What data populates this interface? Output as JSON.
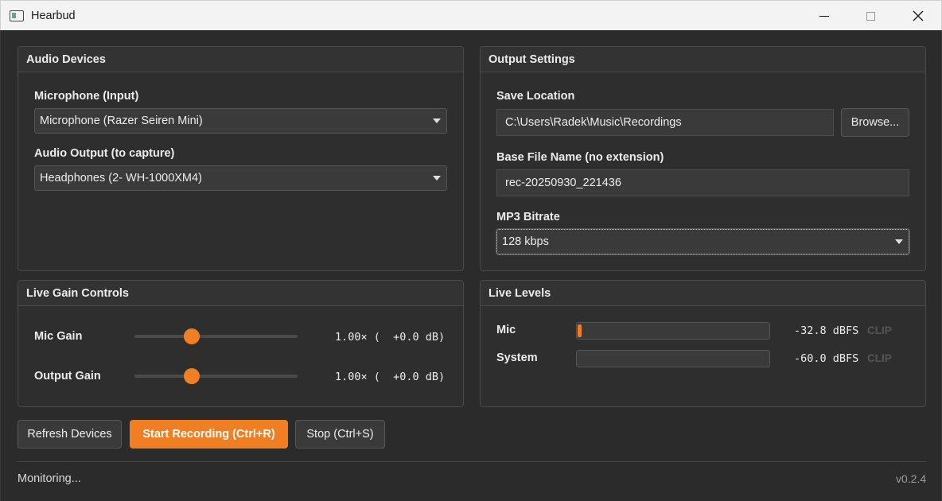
{
  "window": {
    "title": "Hearbud"
  },
  "audio_devices": {
    "header": "Audio Devices",
    "mic_label": "Microphone (Input)",
    "mic_value": "Microphone (Razer Seiren Mini)",
    "output_label": "Audio Output (to capture)",
    "output_value": "Headphones (2- WH-1000XM4)"
  },
  "output_settings": {
    "header": "Output Settings",
    "save_location_label": "Save Location",
    "save_location_value": "C:\\Users\\Radek\\Music\\Recordings",
    "browse_label": "Browse...",
    "base_name_label": "Base File Name (no extension)",
    "base_name_value": "rec-20250930_221436",
    "bitrate_label": "MP3 Bitrate",
    "bitrate_value": "128 kbps"
  },
  "gain": {
    "header": "Live Gain Controls",
    "mic_label": "Mic Gain",
    "mic_readout": "1.00× (  +0.0 dB)",
    "mic_level": 0.35,
    "output_label": "Output Gain",
    "output_readout": "1.00× (  +0.0 dB)",
    "output_level": 0.35
  },
  "levels": {
    "header": "Live Levels",
    "mic_label": "Mic",
    "mic_readout": "-32.8 dBFS",
    "mic_fill": 0.02,
    "mic_clip": "CLIP",
    "system_label": "System",
    "system_readout": "-60.0 dBFS",
    "system_fill": 0.0,
    "system_clip": "CLIP"
  },
  "actions": {
    "refresh_label": "Refresh Devices",
    "start_label": "Start Recording (Ctrl+R)",
    "stop_label": "Stop (Ctrl+S)"
  },
  "status": {
    "text": "Monitoring...",
    "version": "v0.2.4"
  },
  "colors": {
    "accent": "#f07f24",
    "background": "#2b2b2b",
    "panel": "#2e2e2e"
  },
  "icons": {
    "app": "app-window-icon",
    "minimize": "minimize-icon",
    "maximize": "maximize-icon",
    "close": "close-icon",
    "dropdown": "chevron-down-icon"
  }
}
